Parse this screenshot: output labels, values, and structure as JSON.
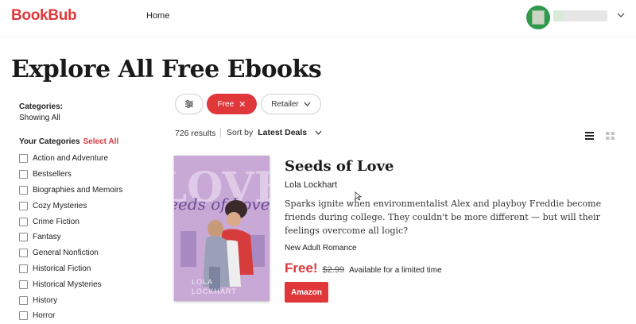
{
  "header": {
    "logo": "BookBub",
    "nav_home": "Home",
    "user_chevron_icon": "chevron-down-icon"
  },
  "page": {
    "title": "Explore All Free Ebooks"
  },
  "sidebar": {
    "categories_heading": "Categories:",
    "categories_showing": "Showing All",
    "your_categories": "Your Categories",
    "select_all": "Select All",
    "items": [
      {
        "label": "Action and Adventure"
      },
      {
        "label": "Bestsellers"
      },
      {
        "label": "Biographies and Memoirs"
      },
      {
        "label": "Cozy Mysteries"
      },
      {
        "label": "Crime Fiction"
      },
      {
        "label": "Fantasy"
      },
      {
        "label": "General Nonfiction"
      },
      {
        "label": "Historical Fiction"
      },
      {
        "label": "Historical Mysteries"
      },
      {
        "label": "History"
      },
      {
        "label": "Horror"
      }
    ]
  },
  "filters": {
    "settings_icon": "sliders-icon",
    "free_label": "Free",
    "free_close": "✕",
    "retailer_label": "Retailer",
    "retailer_chevron": "⌄"
  },
  "results": {
    "count_text": "726 results",
    "sort_label": "Sort by",
    "sort_value": "Latest Deals",
    "sort_chevron": "⌄"
  },
  "book": {
    "cover_title_text": "Seeds of Love",
    "cover_author_line1": "LOLA",
    "cover_author_line2": "LOCKHART",
    "title": "Seeds of Love",
    "author": "Lola Lockhart",
    "description": "Sparks ignite when environmentalist Alex and playboy Freddie become friends during college. They couldn't be more different — but will their feelings overcome all logic?",
    "genre": "New Adult Romance",
    "price_free": "Free!",
    "price_old": "$2.99",
    "price_note": "Available for a limited time",
    "retailer_button": "Amazon"
  },
  "colors": {
    "brand": "#e0373a",
    "cover_bg": "#c8a9d6"
  }
}
